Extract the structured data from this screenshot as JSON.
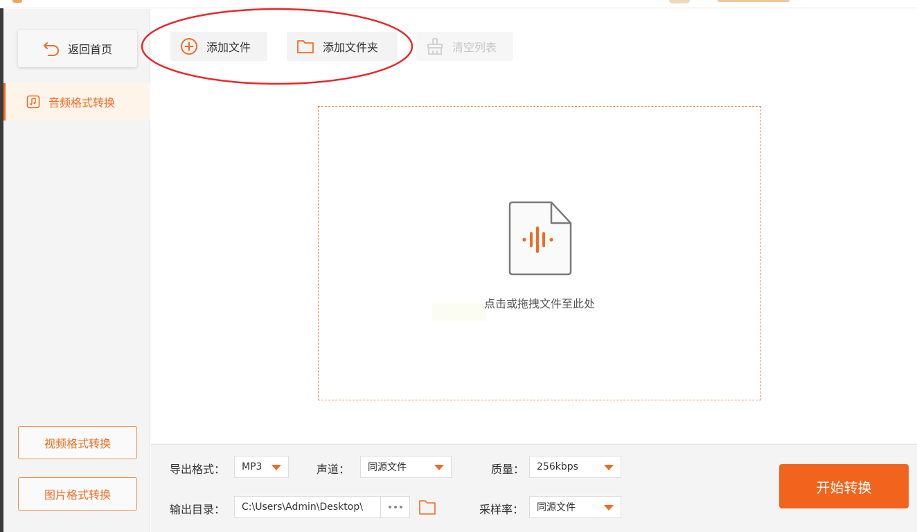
{
  "sidebar": {
    "back_label": "返回首页",
    "active_item_label": "音频格式转换",
    "video_label": "视频格式转换",
    "image_label": "图片格式转换"
  },
  "toolbar": {
    "add_file_label": "添加文件",
    "add_folder_label": "添加文件夹",
    "clear_list_label": "清空列表"
  },
  "dropzone": {
    "hint": "点击或拖拽文件至此处"
  },
  "settings": {
    "format_label": "导出格式：",
    "format_value": "MP3",
    "channel_label": "声道：",
    "channel_value": "同源文件",
    "quality_label": "质量：",
    "quality_value": "256kbps",
    "output_label": "输出目录：",
    "output_path": "C:\\Users\\Admin\\Desktop\\",
    "sample_rate_label": "采样率：",
    "sample_rate_value": "同源文件",
    "start_label": "开始转换"
  },
  "colors": {
    "accent": "#f26b21",
    "annotation": "#e8272b"
  }
}
